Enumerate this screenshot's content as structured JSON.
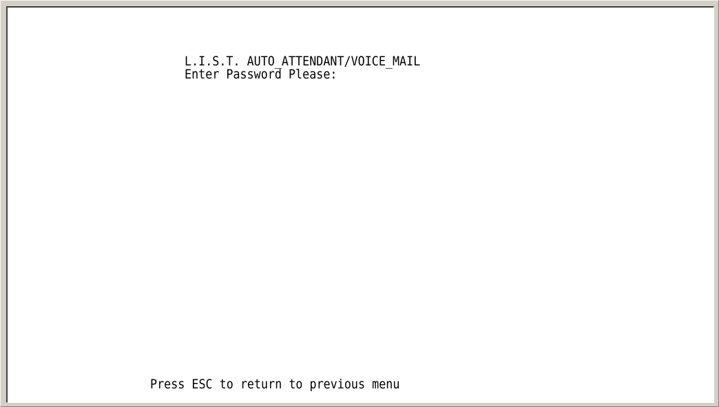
{
  "terminal": {
    "title": "L.I.S.T. AUTO_ATTENDANT/VOICE_MAIL",
    "prompt": "Enter Password Please:",
    "footer": "Press ESC to return to previous menu"
  }
}
